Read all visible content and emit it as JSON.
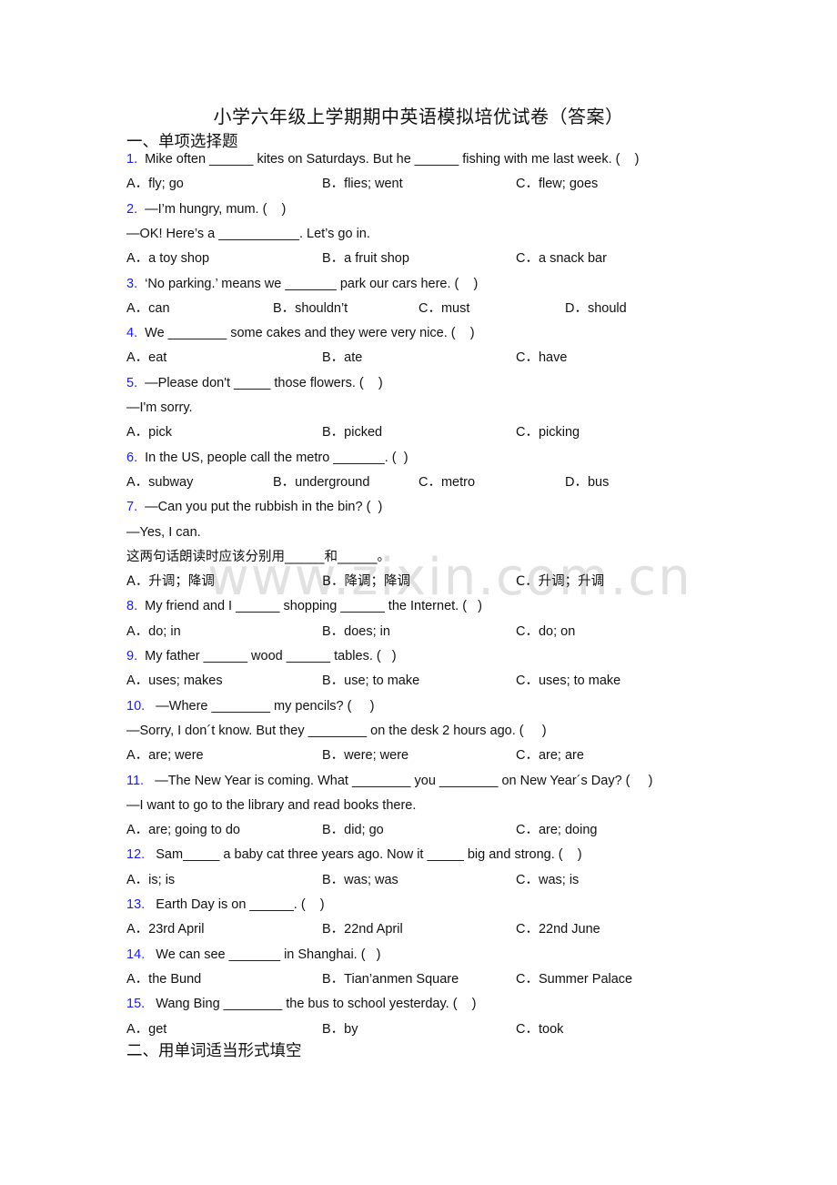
{
  "title": "小学六年级上学期期中英语模拟培优试卷（答案）",
  "watermark": "www.zixin.com.cn",
  "colors": {
    "question_number": "#1a1aff",
    "text": "#111111",
    "watermark": "#c8c8c8"
  },
  "section1": {
    "heading": "一、单项选择题"
  },
  "section2": {
    "heading": "二、用单词适当形式填空"
  },
  "questions": [
    {
      "num": "1.",
      "lines": [
        "Mike often ______ kites on Saturdays. But he ______ fishing with me last week. (    )"
      ],
      "options": [
        "A．fly; go",
        "B．flies; went",
        "C．flew; goes"
      ]
    },
    {
      "num": "2.",
      "lines": [
        "—I’m hungry, mum. (    )",
        "—OK! Here’s a ___________. Let’s go in."
      ],
      "options": [
        "A．a toy shop",
        "B．a fruit shop",
        "C．a snack bar"
      ]
    },
    {
      "num": "3.",
      "lines": [
        "‘No parking.’ means we _______ park our cars here. (    )"
      ],
      "options": [
        "A．can",
        "B．shouldn’t",
        "C．must",
        "D．should"
      ]
    },
    {
      "num": "4.",
      "lines": [
        "We ________ some cakes and they were very nice. (    )"
      ],
      "options": [
        "A．eat",
        "B．ate",
        "C．have"
      ]
    },
    {
      "num": "5.",
      "lines": [
        "—Please don't _____ those flowers. (    )",
        "—I'm sorry."
      ],
      "options": [
        "A．pick",
        "B．picked",
        "C．picking"
      ]
    },
    {
      "num": "6.",
      "lines": [
        "In the US, people call the metro _______. (  )"
      ],
      "options": [
        "A．subway",
        "B．underground",
        "C．metro",
        "D．bus"
      ]
    },
    {
      "num": "7.",
      "lines": [
        "—Can you put the rubbish in the bin? (  )",
        "—Yes, I can.",
        "这两句话朗读时应该分别用______和______。"
      ],
      "options": [
        "A．升调；降调",
        "B．降调；降调",
        "C．升调；升调"
      ]
    },
    {
      "num": "8.",
      "lines": [
        "My friend and I ______ shopping ______ the Internet. (   )"
      ],
      "options": [
        "A．do; in",
        "B．does; in",
        "C．do; on"
      ]
    },
    {
      "num": "9.",
      "lines": [
        "My father ______ wood ______ tables. (   )"
      ],
      "options": [
        "A．uses; makes",
        "B．use; to make",
        "C．uses; to make"
      ]
    },
    {
      "num": "10.",
      "lines": [
        "—Where ________ my pencils? (     )",
        "—Sorry, I don´t know. But they ________ on the desk 2 hours ago. (     )"
      ],
      "options": [
        "A．are; were",
        "B．were; were",
        "C．are; are"
      ]
    },
    {
      "num": "11.",
      "lines": [
        "—The New Year is coming. What ________ you ________ on New Year´s Day? (     )",
        "—I want to go to the library and read books there."
      ],
      "options": [
        "A．are; going to do",
        "B．did; go",
        "C．are; doing"
      ]
    },
    {
      "num": "12.",
      "lines": [
        "Sam_____ a baby cat three years ago. Now it _____ big and strong. (    )"
      ],
      "options": [
        "A．is; is",
        "B．was; was",
        "C．was; is"
      ]
    },
    {
      "num": "13.",
      "lines": [
        "Earth Day is on ______. (    )"
      ],
      "options": [
        "A．23rd April",
        "B．22nd April",
        "C．22nd June"
      ]
    },
    {
      "num": "14.",
      "lines": [
        "We can see _______ in Shanghai. (   )"
      ],
      "options": [
        "A．the Bund",
        "B．Tian’anmen Square",
        "C．Summer Palace"
      ]
    },
    {
      "num": "15.",
      "lines": [
        "Wang Bing ________ the bus to school yesterday. (    )"
      ],
      "options": [
        "A．get",
        "B．by",
        "C．took"
      ]
    }
  ]
}
